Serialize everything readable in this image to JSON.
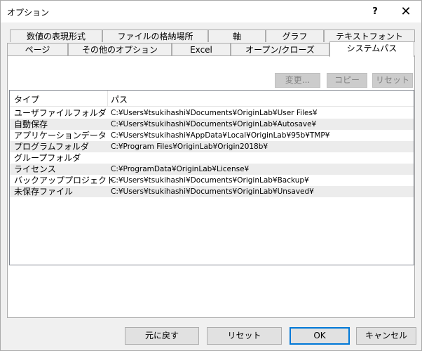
{
  "window": {
    "title": "オプション",
    "help_label": "?",
    "close_label": "✕"
  },
  "tabs_back": [
    "数値の表現形式",
    "ファイルの格納場所",
    "軸",
    "グラフ",
    "テキストフォント"
  ],
  "tabs_front": [
    "ページ",
    "その他のオプション",
    "Excel",
    "オープン/クローズ",
    "システムパス"
  ],
  "active_tab": "システムパス",
  "panel_buttons": {
    "change_label": "変更...",
    "copy_label": "コピー",
    "reset_label": "リセット"
  },
  "list": {
    "columns": [
      "タイプ",
      "パス"
    ],
    "rows": [
      {
        "type": "ユーザファイルフォルダ",
        "path": "C:¥Users¥tsukihashi¥Documents¥OriginLab¥User Files¥"
      },
      {
        "type": "自動保存",
        "path": "C:¥Users¥tsukihashi¥Documents¥OriginLab¥Autosave¥"
      },
      {
        "type": "アプリケーションデータ",
        "path": "C:¥Users¥tsukihashi¥AppData¥Local¥OriginLab¥95b¥TMP¥"
      },
      {
        "type": "プログラムフォルダ",
        "path": "C:¥Program Files¥OriginLab¥Origin2018b¥"
      },
      {
        "type": "グループフォルダ",
        "path": ""
      },
      {
        "type": "ライセンス",
        "path": "C:¥ProgramData¥OriginLab¥License¥"
      },
      {
        "type": "バックアッププロジェクト",
        "path": "C:¥Users¥tsukihashi¥Documents¥OriginLab¥Backup¥"
      },
      {
        "type": "未保存ファイル",
        "path": "C:¥Users¥tsukihashi¥Documents¥OriginLab¥Unsaved¥"
      }
    ]
  },
  "footer": {
    "revert_label": "元に戻す",
    "reset_label": "リセット",
    "ok_label": "OK",
    "cancel_label": "キャンセル"
  }
}
